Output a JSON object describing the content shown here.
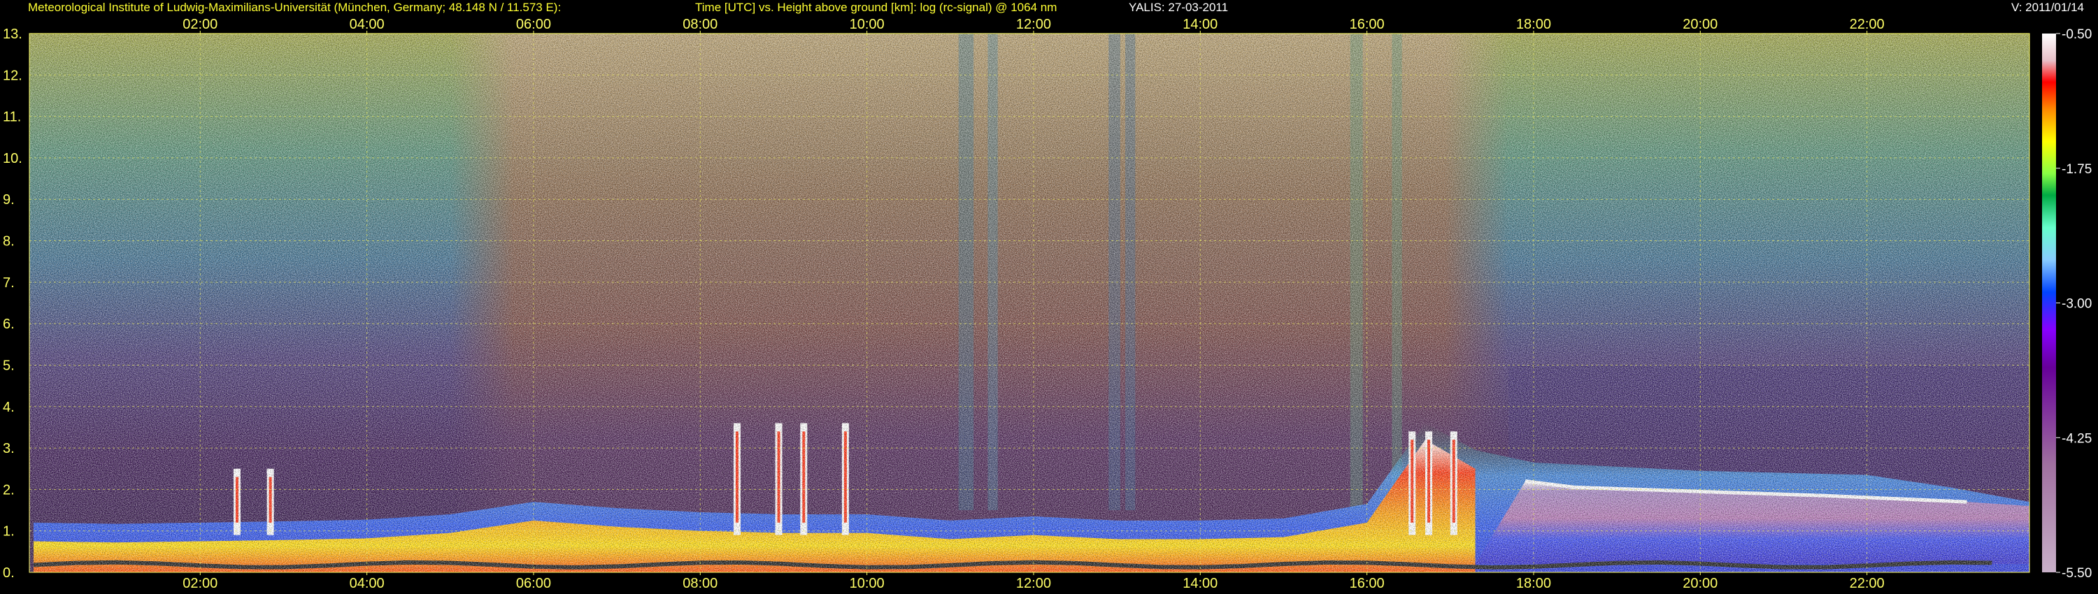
{
  "header": {
    "institute": "Meteorological Institute of Ludwig-Maximilians-Universität (München, Germany; 48.148 N / 11.573 E):",
    "title": "Time [UTC] vs. Height above ground [km]: log (rc-signal) @ 1064 nm",
    "station": "YALIS: 27-03-2011",
    "version": "V: 2011/01/14"
  },
  "chart_data": {
    "type": "heatmap",
    "title": "Time [UTC] vs. Height above ground [km]: log (rc-signal) @ 1064 nm",
    "x_tick_labels": [
      "02:00",
      "04:00",
      "06:00",
      "08:00",
      "10:00",
      "12:00",
      "14:00",
      "16:00",
      "18:00",
      "20:00",
      "22:00"
    ],
    "x_ticks_hours": [
      2,
      4,
      6,
      8,
      10,
      12,
      14,
      16,
      18,
      20,
      22
    ],
    "xlim_hours": [
      -0.05,
      23.95
    ],
    "y_tick_labels": [
      "0.",
      "1.",
      "2.",
      "3.",
      "4.",
      "5.",
      "6.",
      "7.",
      "8.",
      "9.",
      "10.",
      "11.",
      "12.",
      "13."
    ],
    "y_ticks_km": [
      0,
      1,
      2,
      3,
      4,
      5,
      6,
      7,
      8,
      9,
      10,
      11,
      12,
      13
    ],
    "ylim_km": [
      0,
      13
    ],
    "grid": true,
    "colorbar": {
      "labels": [
        "-0.50",
        "-1.75",
        "-3.00",
        "-4.25",
        "-5.50"
      ],
      "range": [
        -5.5,
        -0.5
      ],
      "colors": [
        "#ffffff",
        "#ff0000",
        "#ff9900",
        "#ffff00",
        "#66ff66",
        "#00aa44",
        "#88ccff",
        "#0044ff",
        "#aa00ff",
        "#660099",
        "#b080b0",
        "#e0c8e0"
      ]
    },
    "features": {
      "boundary_layer_top_km": [
        {
          "t": 0.0,
          "h": 0.75
        },
        {
          "t": 1.0,
          "h": 0.72
        },
        {
          "t": 2.0,
          "h": 0.75
        },
        {
          "t": 3.0,
          "h": 0.78
        },
        {
          "t": 4.0,
          "h": 0.82
        },
        {
          "t": 5.0,
          "h": 0.95
        },
        {
          "t": 6.0,
          "h": 1.25
        },
        {
          "t": 7.0,
          "h": 1.1
        },
        {
          "t": 8.0,
          "h": 1.0
        },
        {
          "t": 9.0,
          "h": 0.95
        },
        {
          "t": 10.0,
          "h": 0.95
        },
        {
          "t": 11.0,
          "h": 0.8
        },
        {
          "t": 12.0,
          "h": 0.9
        },
        {
          "t": 13.0,
          "h": 0.8
        },
        {
          "t": 14.0,
          "h": 0.8
        },
        {
          "t": 15.0,
          "h": 0.85
        },
        {
          "t": 16.0,
          "h": 1.2
        },
        {
          "t": 16.7,
          "h": 3.2
        },
        {
          "t": 17.3,
          "h": 2.5
        },
        {
          "t": 18.0,
          "h": 2.2
        },
        {
          "t": 20.0,
          "h": 2.0
        },
        {
          "t": 22.0,
          "h": 1.9
        },
        {
          "t": 23.0,
          "h": 1.6
        }
      ],
      "cloud_spikes_hours": [
        2.4,
        2.8,
        8.4,
        8.9,
        9.2,
        9.7,
        16.5,
        16.7,
        17.0
      ],
      "elevated_layer_km": [
        [
          17.9,
          2.2
        ],
        [
          18.5,
          2.05
        ],
        [
          20.0,
          1.95
        ],
        [
          21.5,
          1.85
        ],
        [
          23.2,
          1.7
        ]
      ]
    }
  }
}
